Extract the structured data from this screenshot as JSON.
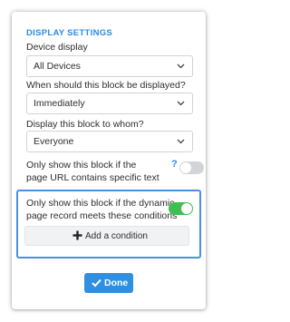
{
  "panel": {
    "section_title": "DISPLAY SETTINGS",
    "device": {
      "label": "Device display",
      "value": "All Devices"
    },
    "timing": {
      "label": "When should this block be displayed?",
      "value": "Immediately"
    },
    "audience": {
      "label": "Display this block to whom?",
      "value": "Everyone"
    },
    "url_condition": {
      "line1": "Only show this block if the",
      "line2": "page URL contains specific text",
      "help": "?",
      "enabled": false
    },
    "record_condition": {
      "line1": "Only show this block if the dynamic",
      "line2": "page record meets these conditions",
      "enabled": true,
      "add_label": "Add a condition"
    },
    "done_label": "Done"
  },
  "colors": {
    "accent": "#2a8be6",
    "toggle_on": "#3fbf4f",
    "toggle_off": "#d2d4d7",
    "highlight_border": "#4a90e2",
    "done_bg": "#2f8fe0"
  },
  "icons": {
    "select_chevron": "chevron-down-icon",
    "help": "question-mark-icon",
    "add": "plus-icon",
    "done": "checkmark-icon"
  }
}
